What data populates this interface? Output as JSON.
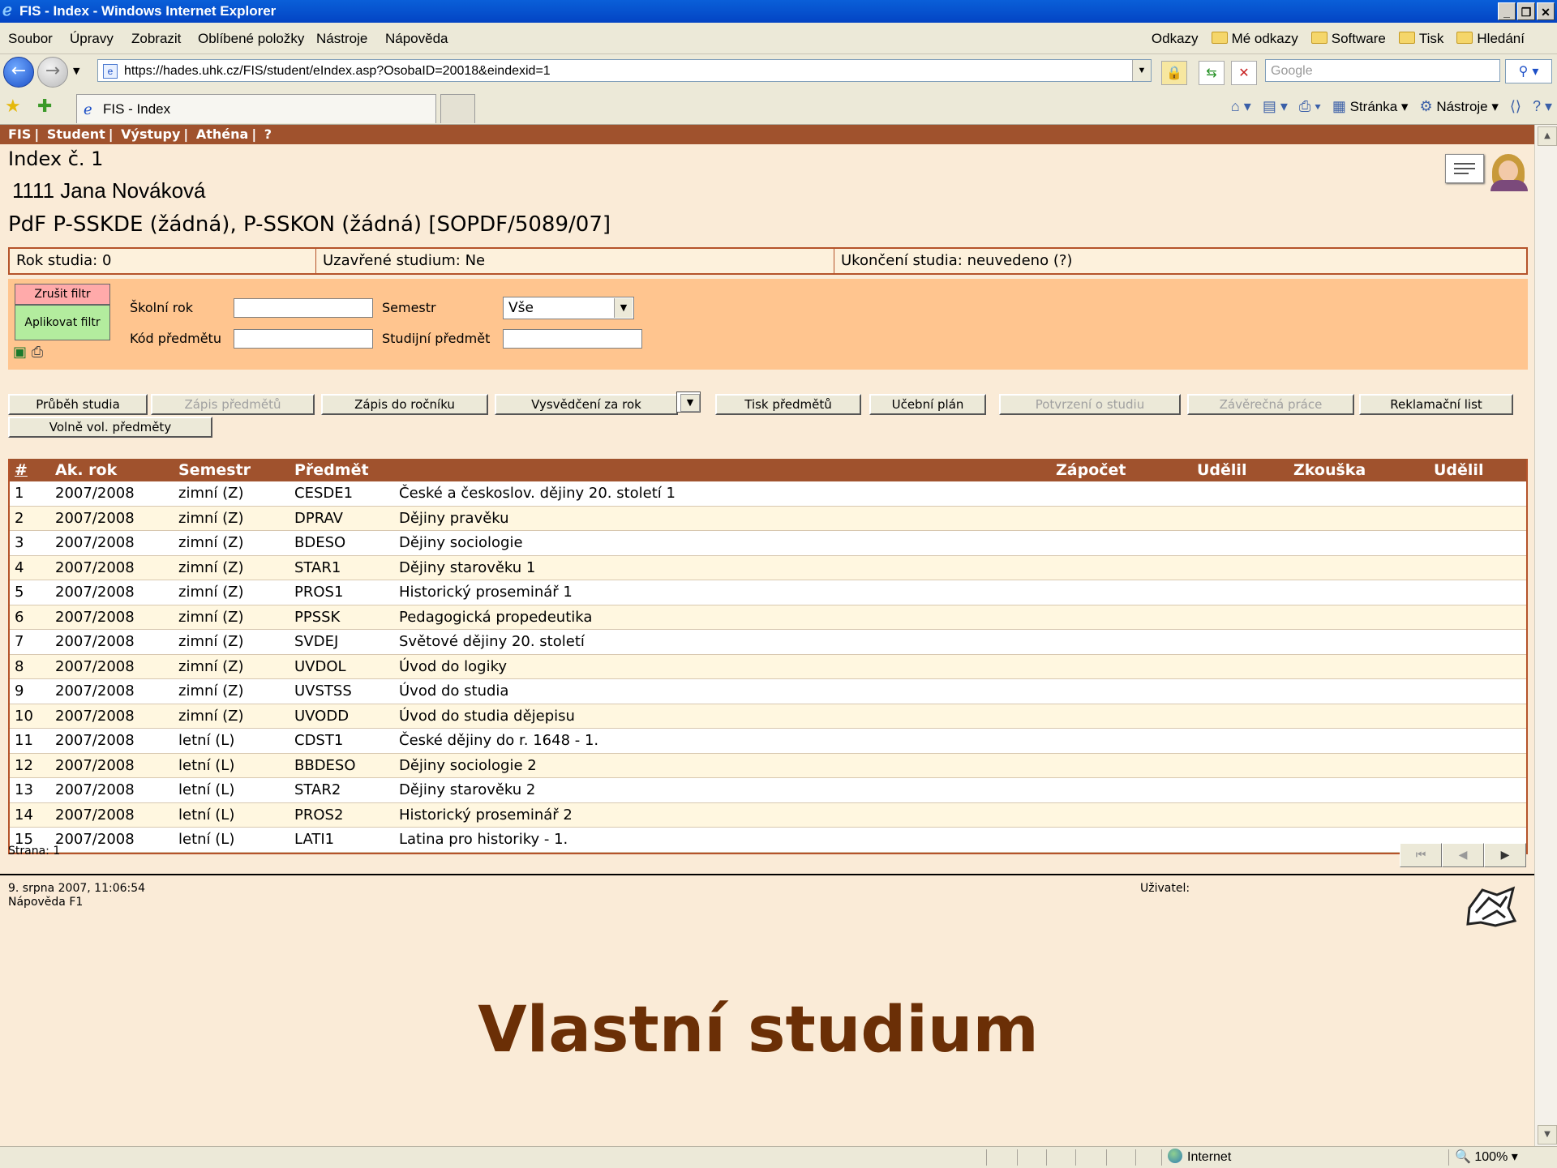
{
  "window": {
    "title": "FIS - Index - Windows Internet Explorer"
  },
  "menubar": {
    "items": [
      "Soubor",
      "Úpravy",
      "Zobrazit",
      "Oblíbené položky",
      "Nástroje",
      "Nápověda"
    ],
    "links_label": "Odkazy",
    "links": [
      "Mé odkazy",
      "Software",
      "Tisk",
      "Hledání"
    ]
  },
  "address": {
    "url": "https://hades.uhk.cz/FIS/student/eIndex.asp?OsobaID=20018&eindexid=1",
    "search_placeholder": "Google"
  },
  "tab": {
    "title": "FIS - Index"
  },
  "commandbar": {
    "page": "Stránka",
    "tools": "Nástroje"
  },
  "appnav": [
    "FIS",
    "Student",
    "Výstupy",
    "Athéna",
    "?"
  ],
  "header": {
    "index_title": "Index č. 1",
    "student_name": "1111 Jana Nováková",
    "program": "PdF P-SSKDE (žádná), P-SSKON (žádná) [SOPDF/5089/07]"
  },
  "info": {
    "year": "Rok studia: 0",
    "closed": "Uzavřené studium: Ne",
    "end": "Ukončení studia: neuvedeno (?)"
  },
  "filter": {
    "clear": "Zrušit filtr",
    "apply": "Aplikovat filtr",
    "school_year_label": "Školní rok",
    "school_year_value": "",
    "semester_label": "Semestr",
    "semester_value": "Vše",
    "course_code_label": "Kód předmětu",
    "course_code_value": "",
    "study_subject_label": "Studijní předmět",
    "study_subject_value": ""
  },
  "actions": {
    "progress": "Průběh studia",
    "enroll_subjects": "Zápis předmětů",
    "enroll_year": "Zápis do ročníku",
    "certificate": "Vysvědčení za rok",
    "print_subjects": "Tisk předmětů",
    "study_plan": "Učební plán",
    "confirmation": "Potvrzení o studiu",
    "thesis": "Závěrečná práce",
    "complaint": "Reklamační list",
    "electives": "Volně vol. předměty"
  },
  "table": {
    "headers": {
      "num": "#",
      "year": "Ak. rok",
      "semester": "Semestr",
      "subject": "Předmět",
      "credit": "Zápočet",
      "granted1": "Udělil",
      "exam": "Zkouška",
      "granted2": "Udělil"
    },
    "rows": [
      {
        "n": "1",
        "year": "2007/2008",
        "sem": "zimní (Z)",
        "code": "CESDE1",
        "name": "České a českoslov. dějiny 20. století 1"
      },
      {
        "n": "2",
        "year": "2007/2008",
        "sem": "zimní (Z)",
        "code": "DPRAV",
        "name": "Dějiny pravěku"
      },
      {
        "n": "3",
        "year": "2007/2008",
        "sem": "zimní (Z)",
        "code": "BDESO",
        "name": "Dějiny sociologie"
      },
      {
        "n": "4",
        "year": "2007/2008",
        "sem": "zimní (Z)",
        "code": "STAR1",
        "name": "Dějiny starověku 1"
      },
      {
        "n": "5",
        "year": "2007/2008",
        "sem": "zimní (Z)",
        "code": "PROS1",
        "name": "Historický proseminář 1"
      },
      {
        "n": "6",
        "year": "2007/2008",
        "sem": "zimní (Z)",
        "code": "PPSSK",
        "name": "Pedagogická propedeutika"
      },
      {
        "n": "7",
        "year": "2007/2008",
        "sem": "zimní (Z)",
        "code": "SVDEJ",
        "name": "Světové dějiny 20. století"
      },
      {
        "n": "8",
        "year": "2007/2008",
        "sem": "zimní (Z)",
        "code": "UVDOL",
        "name": "Úvod do logiky"
      },
      {
        "n": "9",
        "year": "2007/2008",
        "sem": "zimní (Z)",
        "code": "UVSTSS",
        "name": "Úvod do studia"
      },
      {
        "n": "10",
        "year": "2007/2008",
        "sem": "zimní (Z)",
        "code": "UVODD",
        "name": "Úvod do studia dějepisu"
      },
      {
        "n": "11",
        "year": "2007/2008",
        "sem": "letní (L)",
        "code": "CDST1",
        "name": "České dějiny do r. 1648 - 1."
      },
      {
        "n": "12",
        "year": "2007/2008",
        "sem": "letní (L)",
        "code": "BBDESO",
        "name": "Dějiny sociologie 2"
      },
      {
        "n": "13",
        "year": "2007/2008",
        "sem": "letní (L)",
        "code": "STAR2",
        "name": "Dějiny starověku 2"
      },
      {
        "n": "14",
        "year": "2007/2008",
        "sem": "letní (L)",
        "code": "PROS2",
        "name": "Historický proseminář 2"
      },
      {
        "n": "15",
        "year": "2007/2008",
        "sem": "letní (L)",
        "code": "LATI1",
        "name": "Latina pro historiky - 1."
      }
    ]
  },
  "footer": {
    "page": "Strana: 1",
    "datetime": "9. srpna 2007, 11:06:54",
    "help": "Nápověda F1",
    "user_label": "Uživatel:"
  },
  "overlay": {
    "caption": "Vlastní studium"
  },
  "statusbar": {
    "zone": "Internet",
    "zoom": "100%"
  }
}
